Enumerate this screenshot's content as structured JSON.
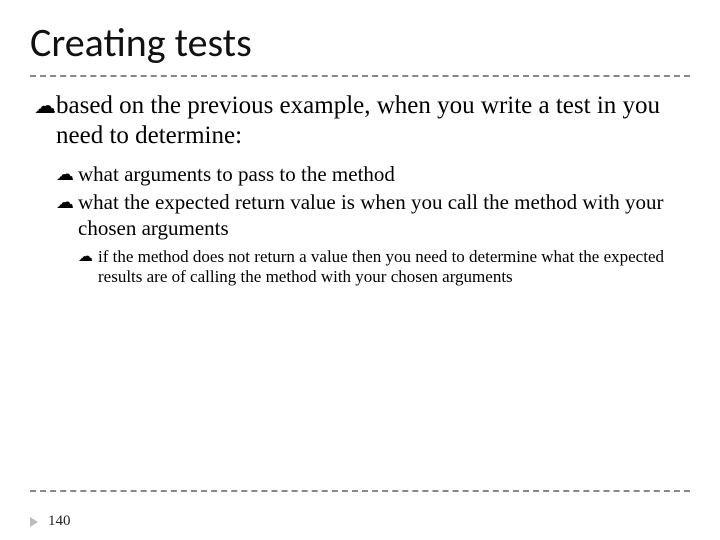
{
  "title": "Creating tests",
  "bullet_glyph": "☁",
  "level1": {
    "text": "based on the previous example, when you write a test in you need to determine:"
  },
  "level2": [
    {
      "text": "what arguments to pass to the method"
    },
    {
      "text": "what the expected return value is when you call the method with your chosen arguments"
    }
  ],
  "level3": [
    {
      "text": "if the method does not return a value then you need to determine what the expected results are of calling the method with your chosen arguments"
    }
  ],
  "page_number": "140"
}
